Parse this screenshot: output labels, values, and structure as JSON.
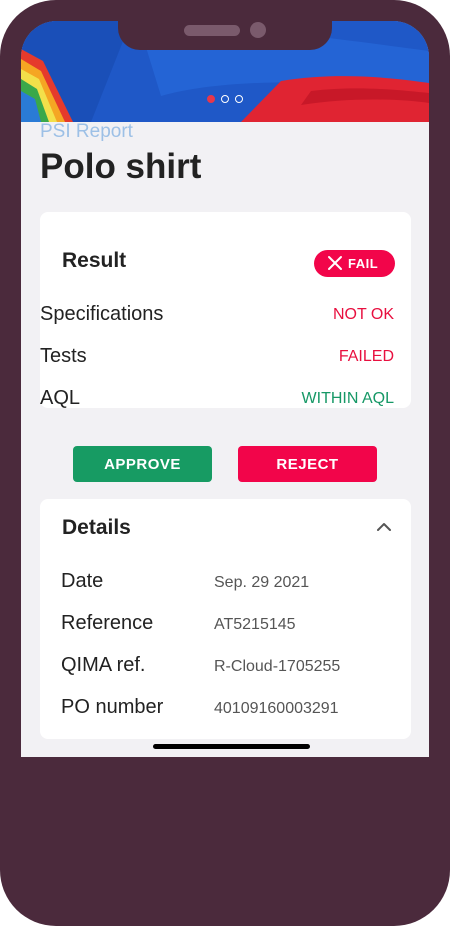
{
  "carousel": {
    "total": 3,
    "active": 0,
    "active_color": "#e8374a"
  },
  "header": {
    "subtitle": "PSI Report",
    "title": "Polo shirt"
  },
  "result": {
    "title": "Result",
    "badge": "FAIL",
    "badge_color": "#f2054a",
    "rows": [
      {
        "label": "Specifications",
        "value": "NOT OK",
        "status": "red"
      },
      {
        "label": "Tests",
        "value": "FAILED",
        "status": "red"
      },
      {
        "label": "AQL",
        "value": "WITHIN AQL",
        "status": "green"
      }
    ]
  },
  "actions": {
    "approve": "APPROVE",
    "reject": "REJECT",
    "approve_color": "#179b63",
    "reject_color": "#f2054a"
  },
  "details": {
    "title": "Details",
    "expanded": true,
    "rows": [
      {
        "label": "Date",
        "value": "Sep. 29 2021"
      },
      {
        "label": "Reference",
        "value": "AT5215145"
      },
      {
        "label": "QIMA ref.",
        "value": "R-Cloud-1705255"
      },
      {
        "label": "PO number",
        "value": "40109160003291"
      }
    ]
  },
  "icons": {
    "fail": "close-x-icon",
    "collapse": "chevron-up-icon"
  }
}
